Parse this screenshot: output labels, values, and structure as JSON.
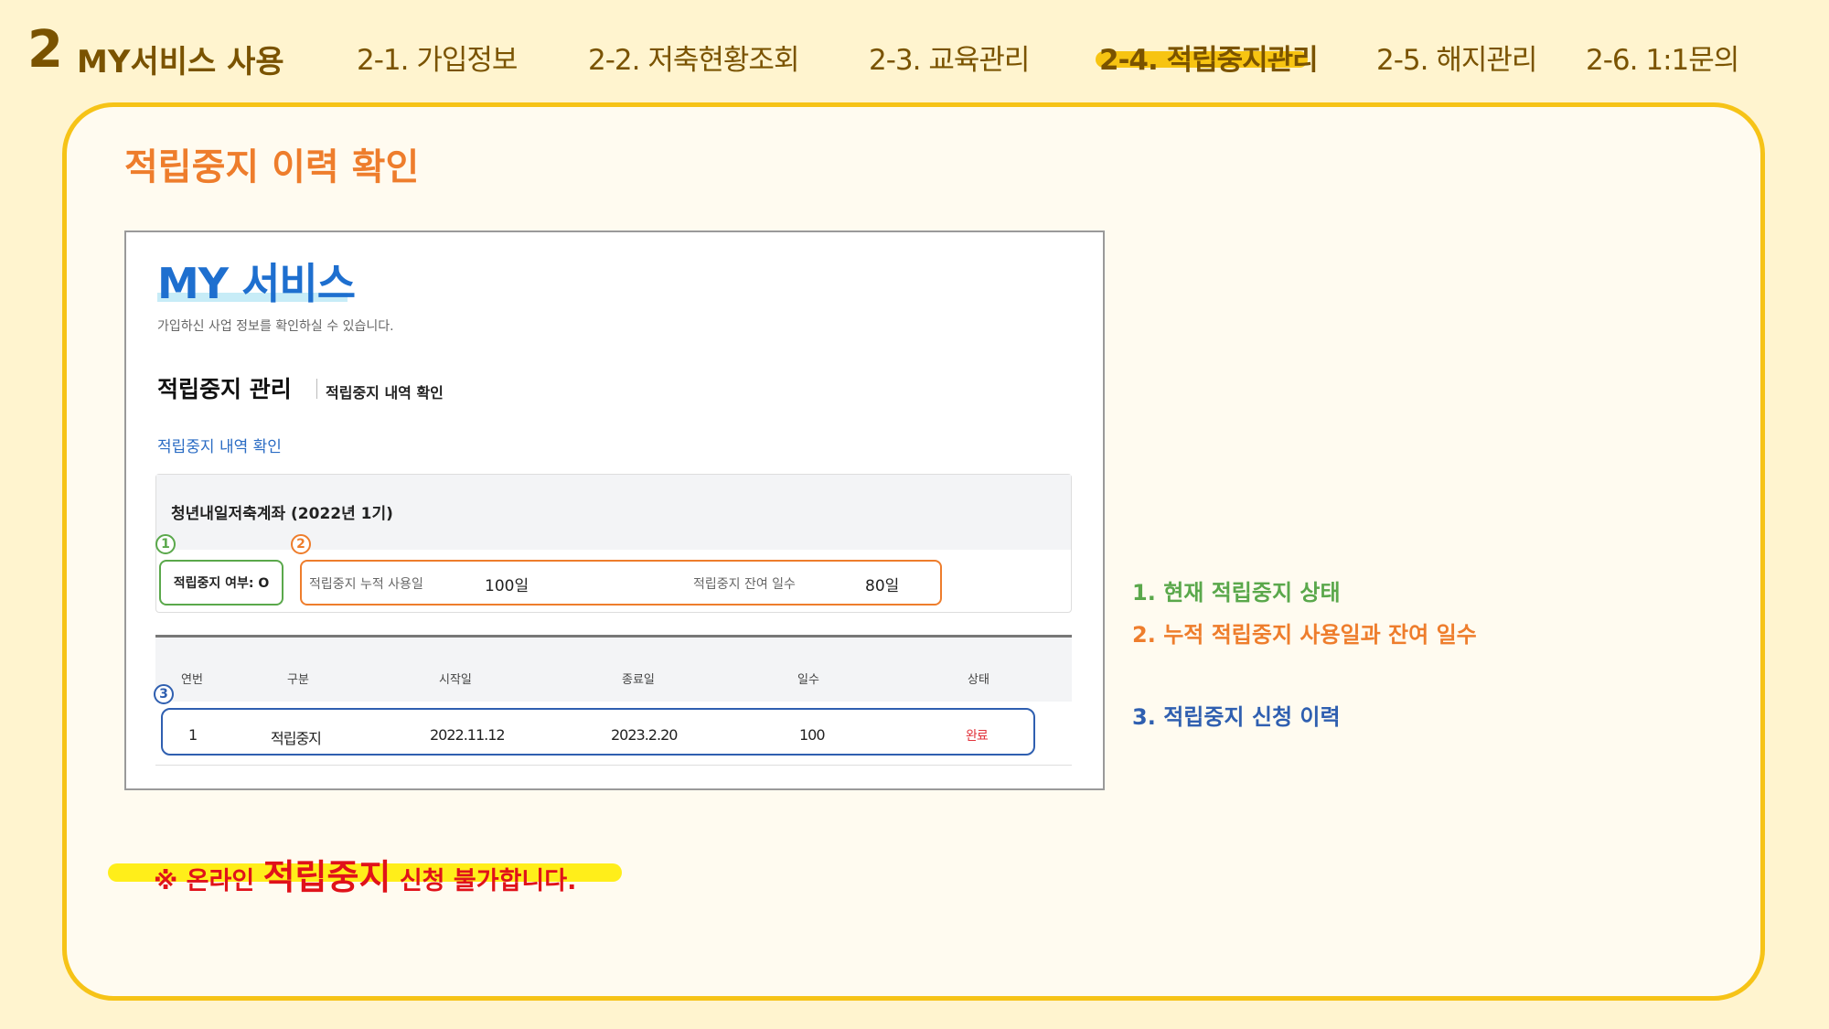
{
  "header": {
    "section_number": "2",
    "section_title": "MY서비스 사용",
    "nav": [
      {
        "label": "2-1. 가입정보"
      },
      {
        "label": "2-2. 저축현황조회"
      },
      {
        "label": "2-3. 교육관리"
      },
      {
        "label": "2-4. 적립중지관리",
        "active": true
      },
      {
        "label": "2-5. 해지관리"
      },
      {
        "label": "2-6. 1:1문의"
      }
    ]
  },
  "main": {
    "title": "적립중지 이력 확인",
    "screenshot": {
      "title": "MY 서비스",
      "subtitle": "가입하신 사업 정보를 확인하실 수 있습니다.",
      "section_heading": "적립중지 관리",
      "section_subheading": "적립중지 내역 확인",
      "tab_link": "적립중지 내역 확인",
      "account_name": "청년내일저축계좌 (2022년 1기)",
      "markers": [
        "1",
        "2",
        "3"
      ],
      "status_box": "적립중지 여부: O",
      "used_days_label": "적립중지 누적 사용일",
      "used_days_value": "100일",
      "remaining_days_label": "적립중지 잔여 일수",
      "remaining_days_value": "80일",
      "table": {
        "columns": [
          "연번",
          "구분",
          "시작일",
          "종료일",
          "일수",
          "상태"
        ],
        "rows": [
          [
            "1",
            "적립중지",
            "2022.11.12",
            "2023.2.20",
            "100",
            "완료"
          ]
        ]
      }
    },
    "legend": [
      {
        "num": "1.",
        "text": "현재 적립중지 상태"
      },
      {
        "num": "2.",
        "text": "누적 적립중지 사용일과 잔여 일수"
      },
      {
        "num": "3.",
        "text": "적립중지 신청 이력"
      }
    ],
    "notice": {
      "prefix": "※ 온라인 ",
      "emphasis": "적립중지",
      "suffix": " 신청 불가합니다."
    }
  },
  "colors": {
    "background": "#fff4cf",
    "accent_yellow": "#f6c317",
    "brown": "#7a5300",
    "orange": "#ee7d2c",
    "green": "#5aa84b",
    "blue": "#2f5fb0",
    "red": "#e0121a"
  }
}
